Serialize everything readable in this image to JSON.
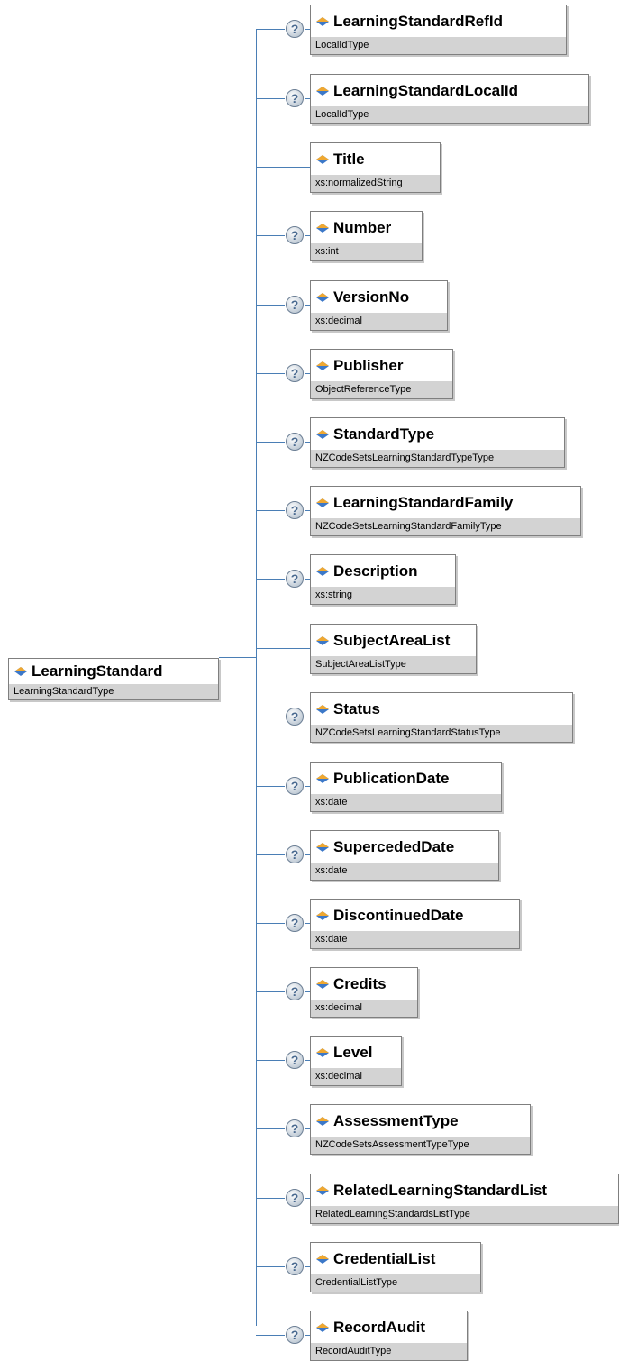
{
  "root": {
    "name": "LearningStandard",
    "type": "LearningStandardType"
  },
  "children": [
    {
      "name": "LearningStandardRefId",
      "type": "LocalIdType",
      "optional": true
    },
    {
      "name": "LearningStandardLocalId",
      "type": "LocalIdType",
      "optional": true
    },
    {
      "name": "Title",
      "type": "xs:normalizedString",
      "optional": false
    },
    {
      "name": "Number",
      "type": "xs:int",
      "optional": true
    },
    {
      "name": "VersionNo",
      "type": "xs:decimal",
      "optional": true
    },
    {
      "name": "Publisher",
      "type": "ObjectReferenceType",
      "optional": true
    },
    {
      "name": "StandardType",
      "type": "NZCodeSetsLearningStandardTypeType",
      "optional": true
    },
    {
      "name": "LearningStandardFamily",
      "type": "NZCodeSetsLearningStandardFamilyType",
      "optional": true
    },
    {
      "name": "Description",
      "type": "xs:string",
      "optional": true
    },
    {
      "name": "SubjectAreaList",
      "type": "SubjectAreaListType",
      "optional": false
    },
    {
      "name": "Status",
      "type": "NZCodeSetsLearningStandardStatusType",
      "optional": true
    },
    {
      "name": "PublicationDate",
      "type": "xs:date",
      "optional": true
    },
    {
      "name": "SupercededDate",
      "type": "xs:date",
      "optional": true
    },
    {
      "name": "DiscontinuedDate",
      "type": "xs:date",
      "optional": true
    },
    {
      "name": "Credits",
      "type": "xs:decimal",
      "optional": true
    },
    {
      "name": "Level",
      "type": "xs:decimal",
      "optional": true
    },
    {
      "name": "AssessmentType",
      "type": "NZCodeSetsAssessmentTypeType",
      "optional": true
    },
    {
      "name": "RelatedLearningStandardList",
      "type": "RelatedLearningStandardsListType",
      "optional": true
    },
    {
      "name": "CredentialList",
      "type": "CredentialListType",
      "optional": true
    },
    {
      "name": "RecordAudit",
      "type": "RecordAuditType",
      "optional": true
    }
  ],
  "colors": {
    "connector": "#4a7eb5",
    "type_band": "#d3d3d3",
    "border": "#7f7f7f"
  },
  "icons": {
    "element": "element-diamond-icon",
    "optional": "question-mark-icon"
  }
}
